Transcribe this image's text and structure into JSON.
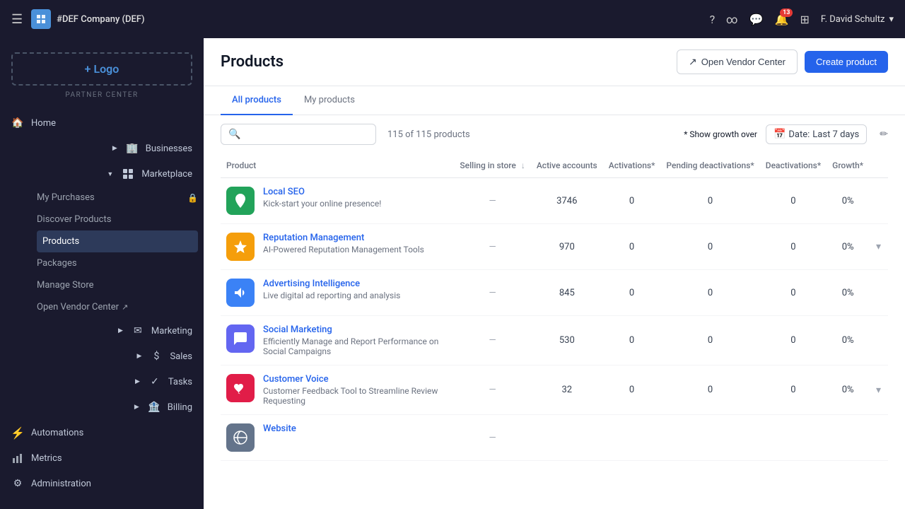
{
  "topnav": {
    "company": "#DEF Company (DEF)",
    "user": "F. David Schultz",
    "notification_count": "13"
  },
  "sidebar": {
    "logo_label": "+ Logo",
    "partner_label": "PARTNER CENTER",
    "items": [
      {
        "id": "home",
        "label": "Home",
        "icon": "🏠",
        "expandable": false
      },
      {
        "id": "businesses",
        "label": "Businesses",
        "icon": "🏢",
        "expandable": true
      },
      {
        "id": "marketplace",
        "label": "Marketplace",
        "icon": "⊞",
        "expandable": true,
        "expanded": true
      },
      {
        "id": "marketing",
        "label": "Marketing",
        "icon": "✉",
        "expandable": true
      },
      {
        "id": "sales",
        "label": "Sales",
        "icon": "💲",
        "expandable": true
      },
      {
        "id": "tasks",
        "label": "Tasks",
        "icon": "✓",
        "expandable": true
      },
      {
        "id": "billing",
        "label": "Billing",
        "icon": "🏦",
        "expandable": true
      },
      {
        "id": "automations",
        "label": "Automations",
        "icon": "⚡",
        "expandable": false
      },
      {
        "id": "metrics",
        "label": "Metrics",
        "icon": "📊",
        "expandable": false
      },
      {
        "id": "administration",
        "label": "Administration",
        "icon": "⚙",
        "expandable": false
      }
    ],
    "marketplace_sub": [
      {
        "id": "my-purchases",
        "label": "My Purchases",
        "has_lock": true
      },
      {
        "id": "discover-products",
        "label": "Discover Products"
      },
      {
        "id": "products",
        "label": "Products",
        "active": true
      },
      {
        "id": "packages",
        "label": "Packages"
      },
      {
        "id": "manage-store",
        "label": "Manage Store"
      },
      {
        "id": "open-vendor-center",
        "label": "Open Vendor Center",
        "external": true
      }
    ]
  },
  "products_page": {
    "title": "Products",
    "btn_vendor_center": "Open Vendor Center",
    "btn_create_product": "Create product",
    "tabs": [
      {
        "id": "all",
        "label": "All products",
        "active": true
      },
      {
        "id": "my",
        "label": "My products",
        "active": false
      }
    ],
    "search_placeholder": "Search...",
    "product_count": "115 of 115 products",
    "show_growth_label": "* Show growth over",
    "date_label": "Date:",
    "date_value": "Last 7 days",
    "columns": [
      {
        "id": "product",
        "label": "Product",
        "sortable": false
      },
      {
        "id": "selling",
        "label": "Selling in store",
        "sortable": true
      },
      {
        "id": "active",
        "label": "Active accounts",
        "sortable": false
      },
      {
        "id": "activations",
        "label": "Activations*",
        "sortable": false
      },
      {
        "id": "pending",
        "label": "Pending deactivations*",
        "sortable": false
      },
      {
        "id": "deactivations",
        "label": "Deactivations*",
        "sortable": false
      },
      {
        "id": "growth",
        "label": "Growth*",
        "sortable": false
      }
    ],
    "products": [
      {
        "id": 1,
        "name": "Local SEO",
        "description": "Kick-start your online presence!",
        "icon_bg": "#22a35a",
        "icon": "📍",
        "selling": "—",
        "active_accounts": "3746",
        "activations": "0",
        "pending_deactivations": "0",
        "deactivations": "0",
        "growth": "0%",
        "expandable": false
      },
      {
        "id": 2,
        "name": "Reputation Management",
        "description": "AI-Powered Reputation Management Tools",
        "icon_bg": "#f59e0b",
        "icon": "⭐",
        "selling": "—",
        "active_accounts": "970",
        "activations": "0",
        "pending_deactivations": "0",
        "deactivations": "0",
        "growth": "0%",
        "expandable": true
      },
      {
        "id": 3,
        "name": "Advertising Intelligence",
        "description": "Live digital ad reporting and analysis",
        "icon_bg": "#3b82f6",
        "icon": "📣",
        "selling": "—",
        "active_accounts": "845",
        "activations": "0",
        "pending_deactivations": "0",
        "deactivations": "0",
        "growth": "0%",
        "expandable": false
      },
      {
        "id": 4,
        "name": "Social Marketing",
        "description": "Efficiently Manage and Report Performance on Social Campaigns",
        "icon_bg": "#6366f1",
        "icon": "💬",
        "selling": "—",
        "active_accounts": "530",
        "activations": "0",
        "pending_deactivations": "0",
        "deactivations": "0",
        "growth": "0%",
        "expandable": false
      },
      {
        "id": 5,
        "name": "Customer Voice",
        "description": "Customer Feedback Tool to Streamline Review Requesting",
        "icon_bg": "#e11d48",
        "icon": "❤",
        "selling": "—",
        "active_accounts": "32",
        "activations": "0",
        "pending_deactivations": "0",
        "deactivations": "0",
        "growth": "0%",
        "expandable": true
      },
      {
        "id": 6,
        "name": "Website",
        "description": "",
        "icon_bg": "#64748b",
        "icon": "🌐",
        "selling": "—",
        "active_accounts": "",
        "activations": "",
        "pending_deactivations": "",
        "deactivations": "",
        "growth": "",
        "expandable": false
      }
    ]
  }
}
